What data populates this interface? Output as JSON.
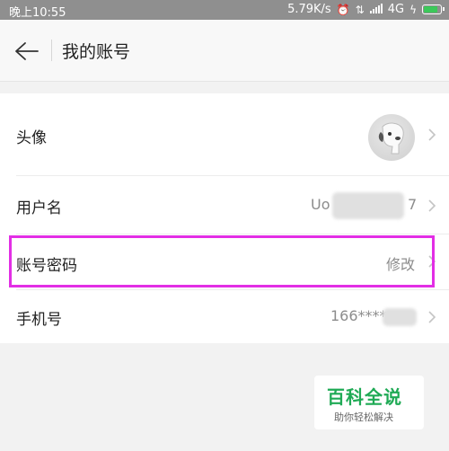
{
  "status_bar": {
    "time": "晚上10:55",
    "speed": "5.79K/s",
    "network": "4G"
  },
  "header": {
    "title": "我的账号"
  },
  "rows": [
    {
      "label": "头像"
    },
    {
      "label": "用户名",
      "value_prefix": "Uo",
      "value_suffix": "7"
    },
    {
      "label": "账号密码",
      "value": "修改"
    },
    {
      "label": "手机号",
      "value": "166****"
    }
  ],
  "watermark": {
    "title": "百科全说",
    "subtitle": "助你轻松解决"
  },
  "colors": {
    "highlight": "#e22ee5",
    "watermark_green": "#1faa55"
  }
}
